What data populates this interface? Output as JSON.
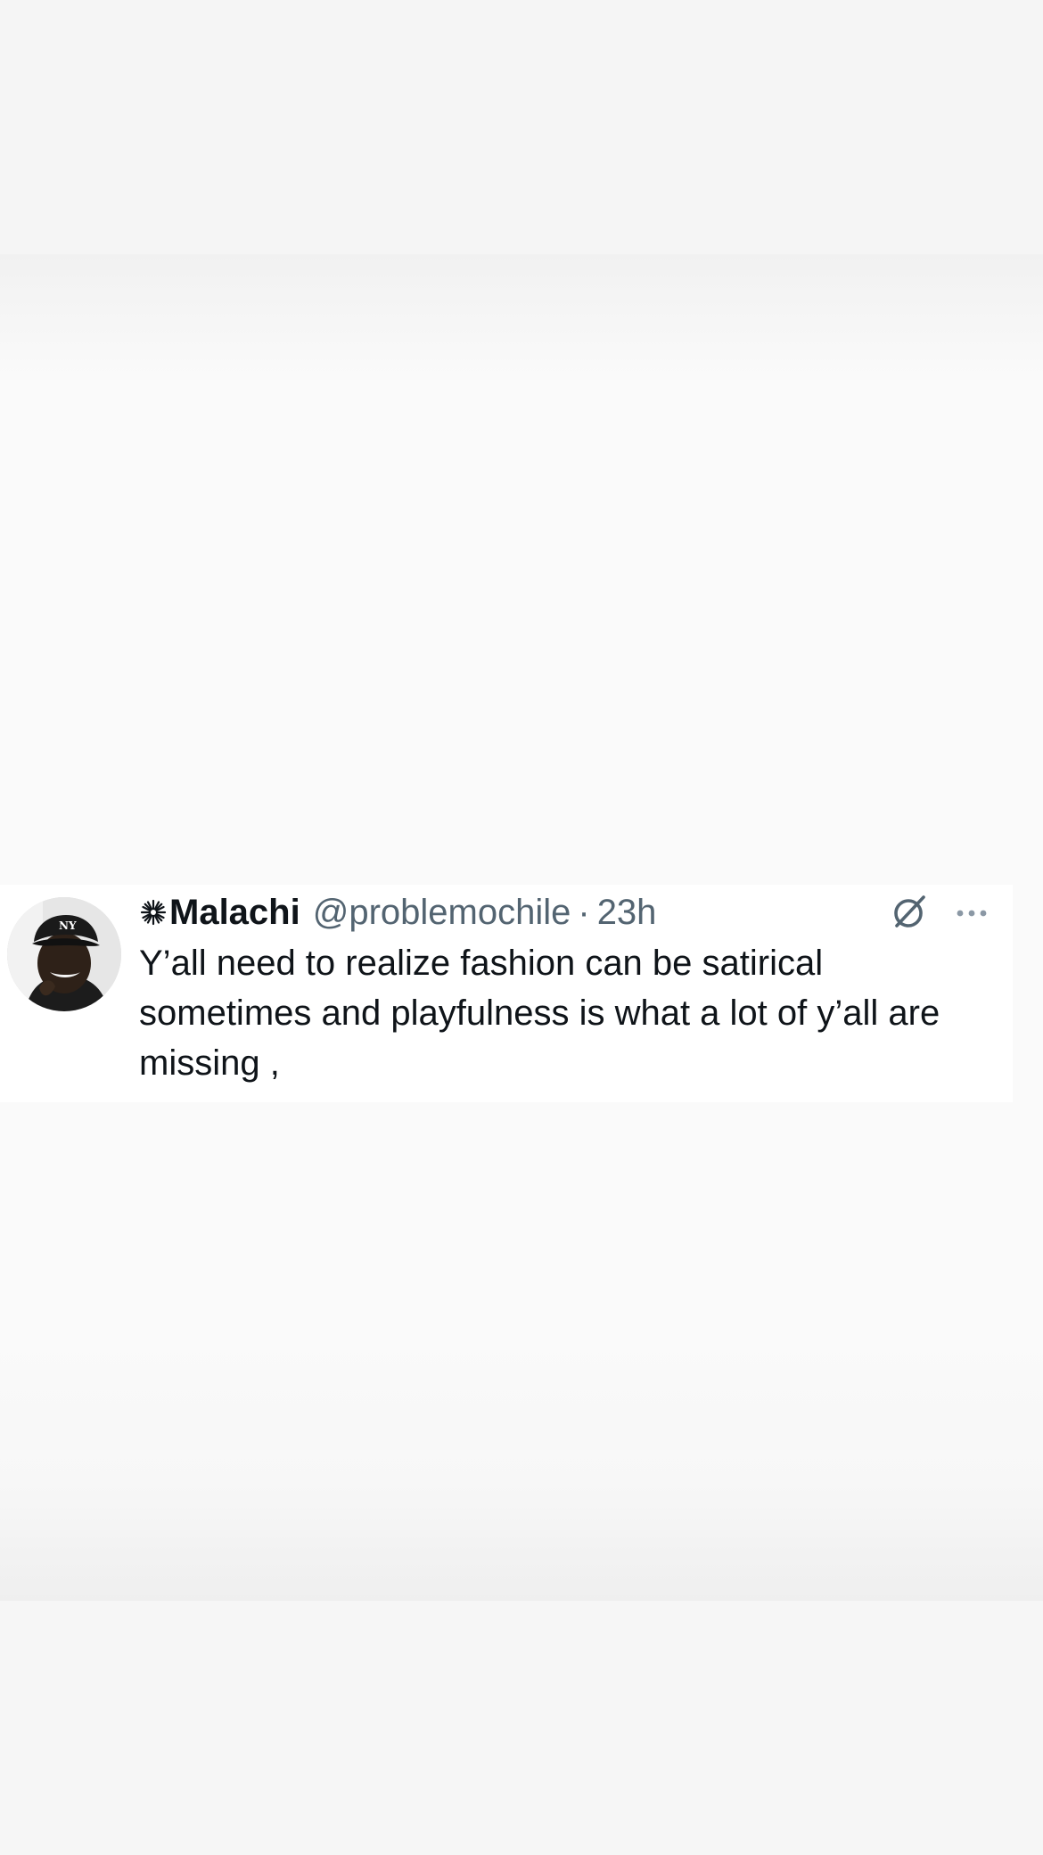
{
  "tweet": {
    "author": {
      "display_name": "Malachi",
      "handle": "@problemochile",
      "name_prefix_icon": "sparkle-icon"
    },
    "separator": "·",
    "time": "23h",
    "text": "Y’all need to realize fashion can be satirical sometimes and playfulness is what a lot of y’all are missing ,",
    "icons": {
      "grok": "grok-icon",
      "more": "more-options-icon"
    }
  },
  "colors": {
    "name_text": "#0f1419",
    "secondary_text": "#536471",
    "card_background": "#ffffff",
    "page_background": "#f6f6f6"
  }
}
